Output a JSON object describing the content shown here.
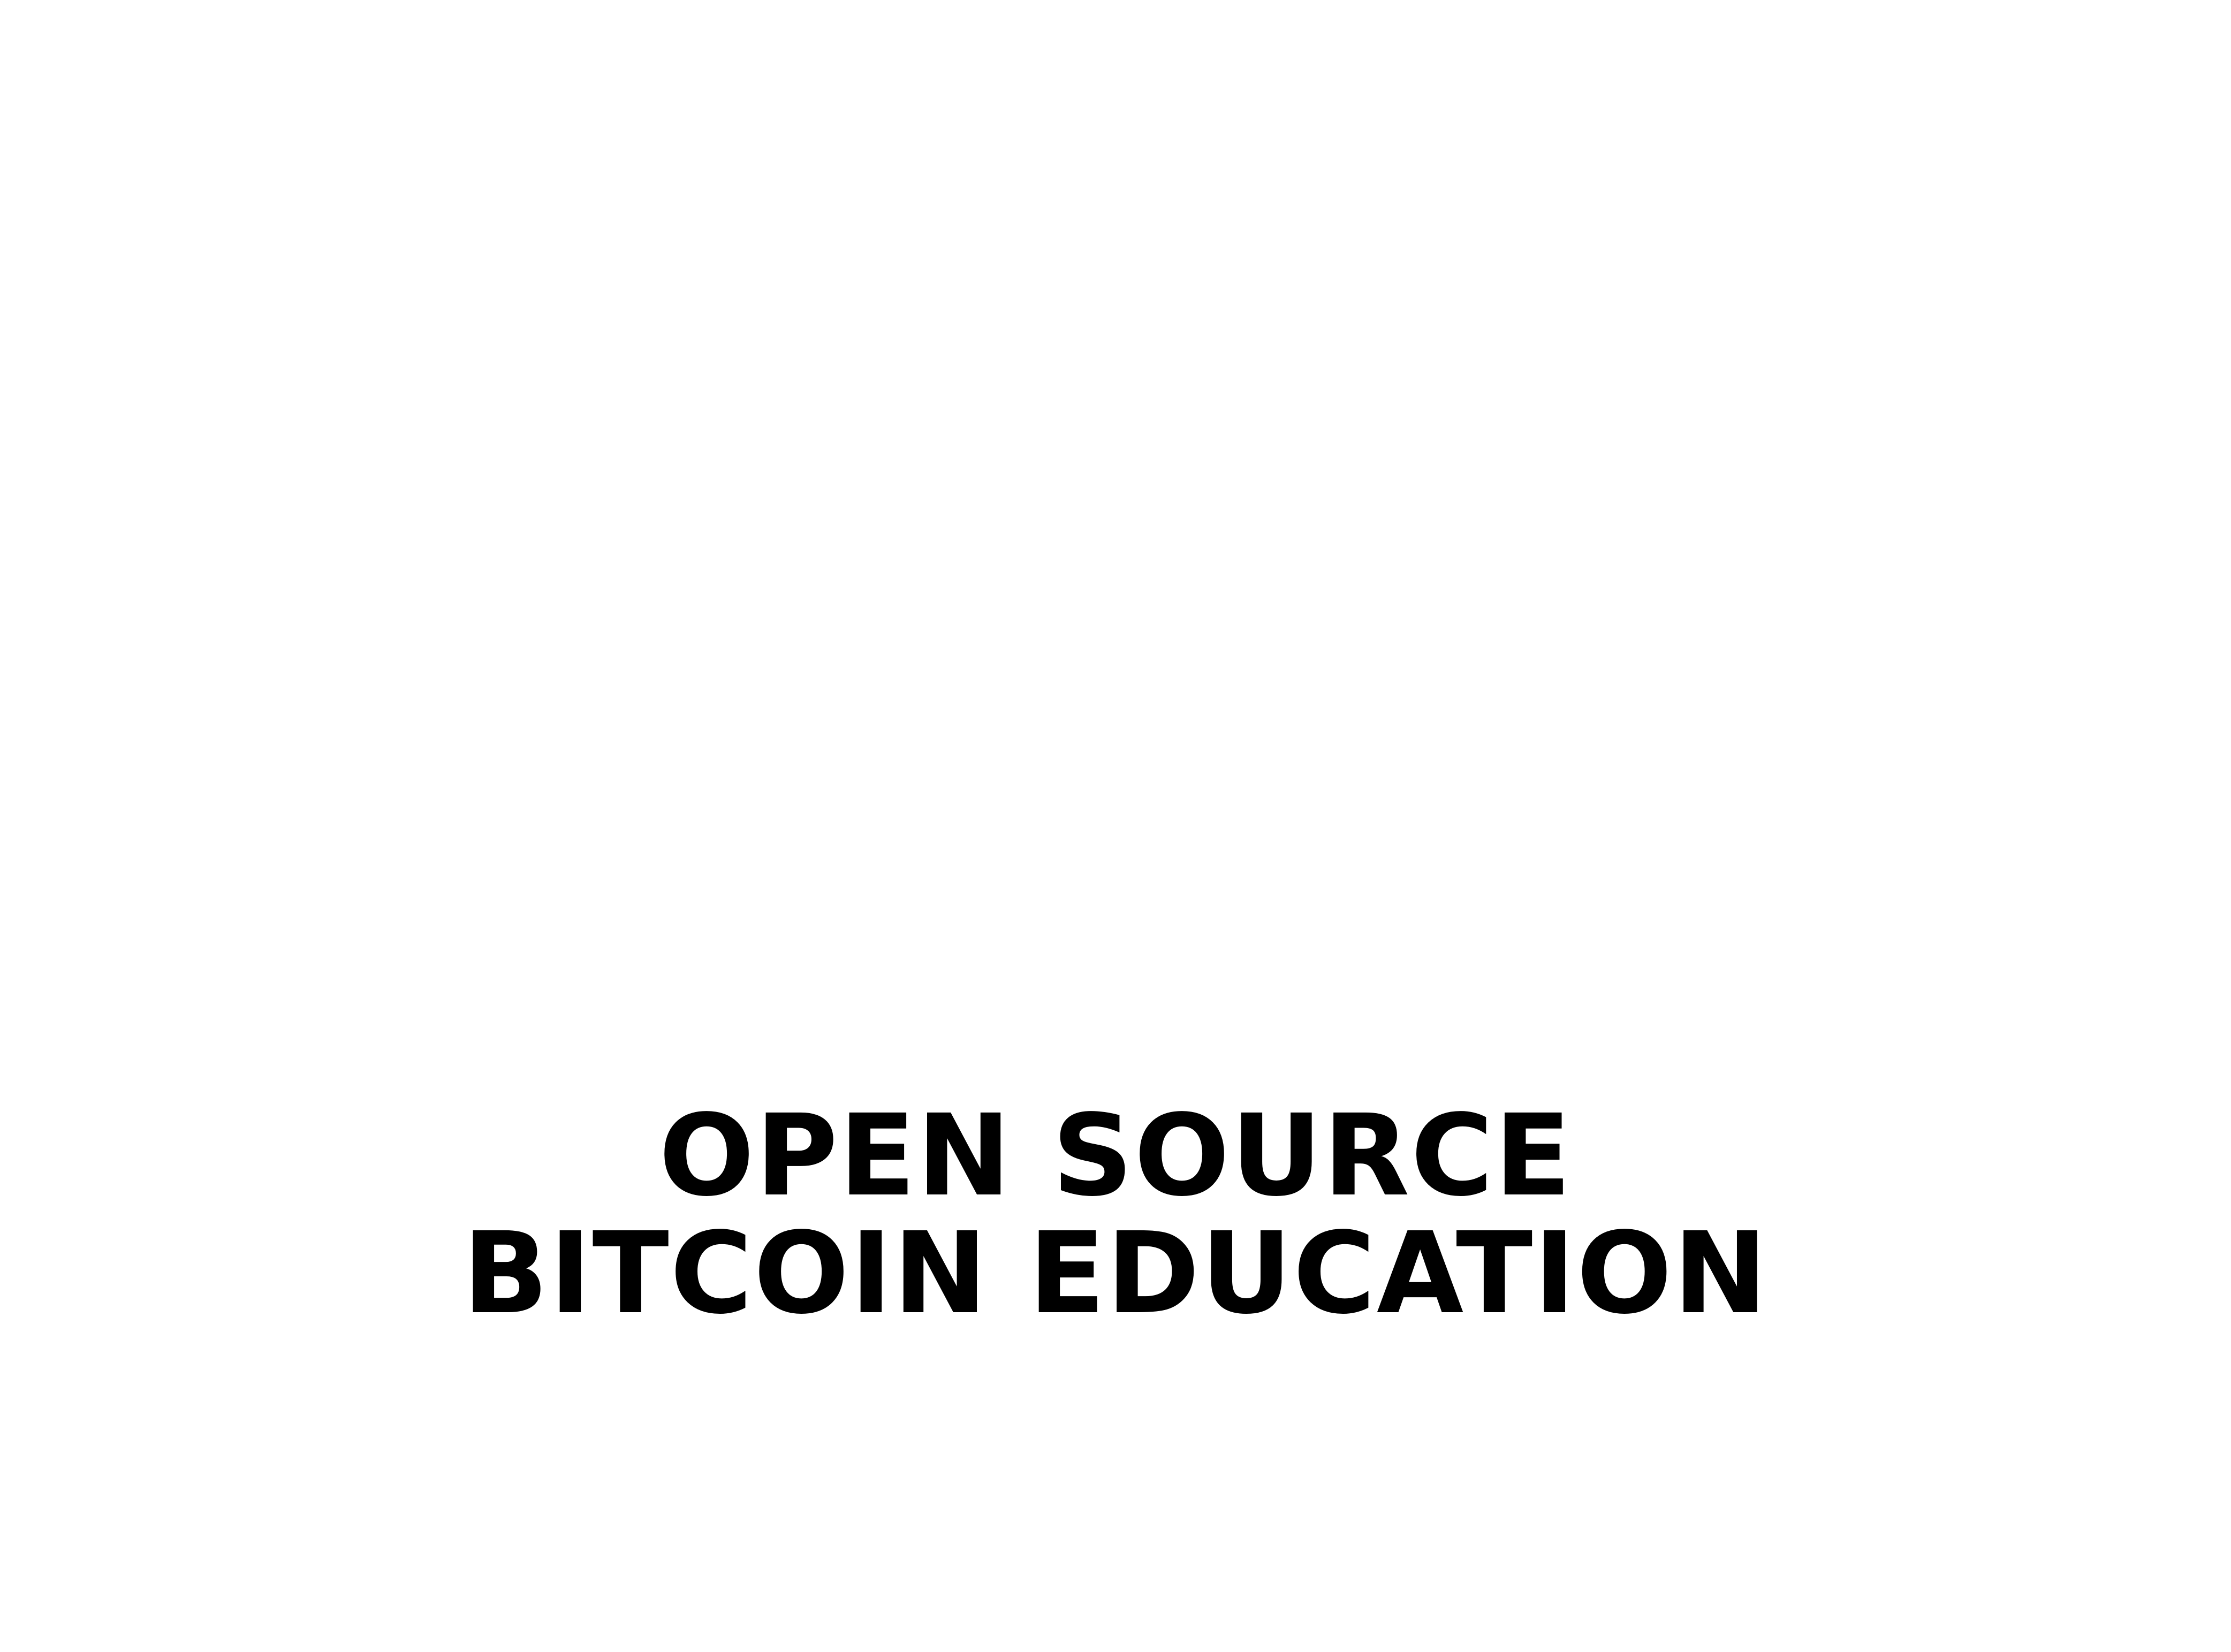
{
  "title": {
    "line1": "OPEN SOURCE",
    "line2": "BITCOIN EDUCATION"
  },
  "colors": {
    "background": "#ffffff",
    "text": "#000000"
  }
}
